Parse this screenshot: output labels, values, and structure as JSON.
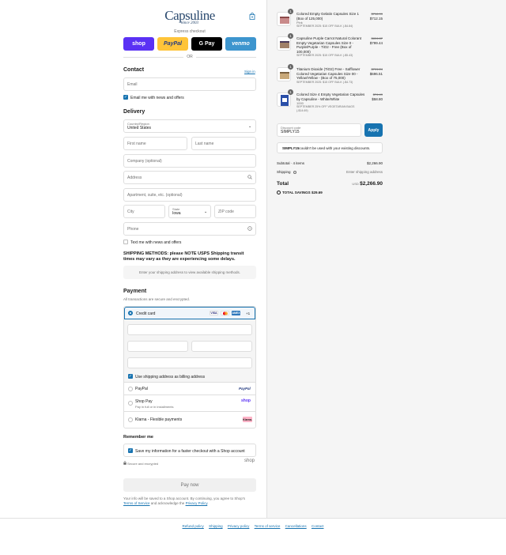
{
  "brand": {
    "logo_text": "Capsuline",
    "since_text": "Since 2003"
  },
  "express": {
    "label": "Express checkout",
    "buttons": [
      {
        "label": "shop",
        "bg": "#5a31f4",
        "color": "#ffffff"
      },
      {
        "label": "PayPal",
        "bg": "#ffc439",
        "color": "#253b80"
      },
      {
        "label": "G Pay",
        "bg": "#000000",
        "color": "#ffffff"
      },
      {
        "label": "venmo",
        "bg": "#3d95ce",
        "color": "#ffffff"
      }
    ],
    "or_label": "OR"
  },
  "contact": {
    "heading": "Contact",
    "sign_in": "Sign in",
    "email_placeholder": "Email",
    "news_label": "Email me with news and offers"
  },
  "delivery": {
    "heading": "Delivery",
    "country_label": "Country/Region",
    "country_value": "United States",
    "first_name": "First name",
    "last_name": "Last name",
    "company": "Company (optional)",
    "address": "Address",
    "apartment": "Apartment, suite, etc. (optional)",
    "city": "City",
    "state_label": "State",
    "state_value": "Iowa",
    "zip": "ZIP code",
    "phone": "Phone",
    "text_label": "Text me with news and offers"
  },
  "shipping": {
    "note": "SHIPPING METHODS: please NOTE USPS Shipping transit times may vary as they are experiencing some delays.",
    "placeholder": "Enter your shipping address to view available shipping methods."
  },
  "payment": {
    "heading": "Payment",
    "subtitle": "All transactions are secure and encrypted.",
    "credit_card": "Credit card",
    "card_badges": [
      "VISA",
      "MC",
      "AMEX"
    ],
    "more_cards": "+1",
    "billing_label": "Use shipping address as billing address",
    "paypal": "PayPal",
    "paypal_badge": "PayPal",
    "shop_pay": "Shop Pay",
    "shop_pay_sub": "Pay in full or in installments",
    "shop_pay_badge": "shop",
    "klarna": "Klarna - Flexible payments",
    "klarna_badge": "Klarna."
  },
  "remember": {
    "heading": "Remember me",
    "label": "Save my information for a faster checkout with a Shop account",
    "secure": "Secure and encrypted",
    "shop_logo": "shop"
  },
  "pay_now": "Pay now",
  "legal": {
    "text": "Your info will be saved to a Shop account. By continuing, you agree to Shop's",
    "terms": "Terms of Service",
    "and_text": " and acknowledge the ",
    "privacy": "Privacy Policy",
    "end": "."
  },
  "footer_links": [
    "Refund policy",
    "Shipping",
    "Privacy policy",
    "Terms of service",
    "Cancellations",
    "Contact"
  ],
  "summary": {
    "items": [
      {
        "qty": "1",
        "title": "Colored Empty Gelatin Capsules Size 1 (Box of 125,000)",
        "variant": "Pink",
        "discount": "SEPTEMBER 2025: $15 OFF BULK (-$4.84)",
        "old_price": "$716.99",
        "price": "$712.15"
      },
      {
        "qty": "1",
        "title": "Capsuline Purple Carrot Natural Colorant Empty Vegetarian Capsules Size 0 - Purple/Purple - TiO2 - Free (Box of 100,000)",
        "variant": "",
        "discount": "SEPTEMBER 2025: $15 OFF BULK (-$5.43)",
        "old_price": "$804.87",
        "price": "$799.44"
      },
      {
        "qty": "1",
        "title": "Titanium Dioxide (TiO2) Free - Safflower Colored Vegetarian Capsules Size 00 - Yellow/Yellow - (Box of 75,000)",
        "variant": "",
        "discount": "SEPTEMBER 2025: $15 OFF BULK (-$4.73)",
        "old_price": "$701.24",
        "price": "$696.51"
      },
      {
        "qty": "1",
        "title": "Colored Size 4 Empty Vegetarian Capsules by Capsuline - White/White",
        "variant": "1000",
        "discount": "SEPTEMBER 25% OFF VEGETARIAN BAGS (-$14.69)",
        "old_price": "$74.49",
        "price": "$58.80"
      }
    ],
    "discount_label": "Discount code",
    "discount_value": "SIMPLY15",
    "apply": "Apply",
    "error_code": "SIMPLY15",
    "error_text": " couldn't be used with your existing discounts.",
    "subtotal_label": "Subtotal · 4 items",
    "subtotal_value": "$2,266.90",
    "shipping_label": "Shipping",
    "shipping_value": "Enter shipping address",
    "total_label": "Total",
    "total_currency": "USD",
    "total_value": "$2,266.90",
    "savings_label": "TOTAL SAVINGS",
    "savings_value": "$29.69"
  }
}
